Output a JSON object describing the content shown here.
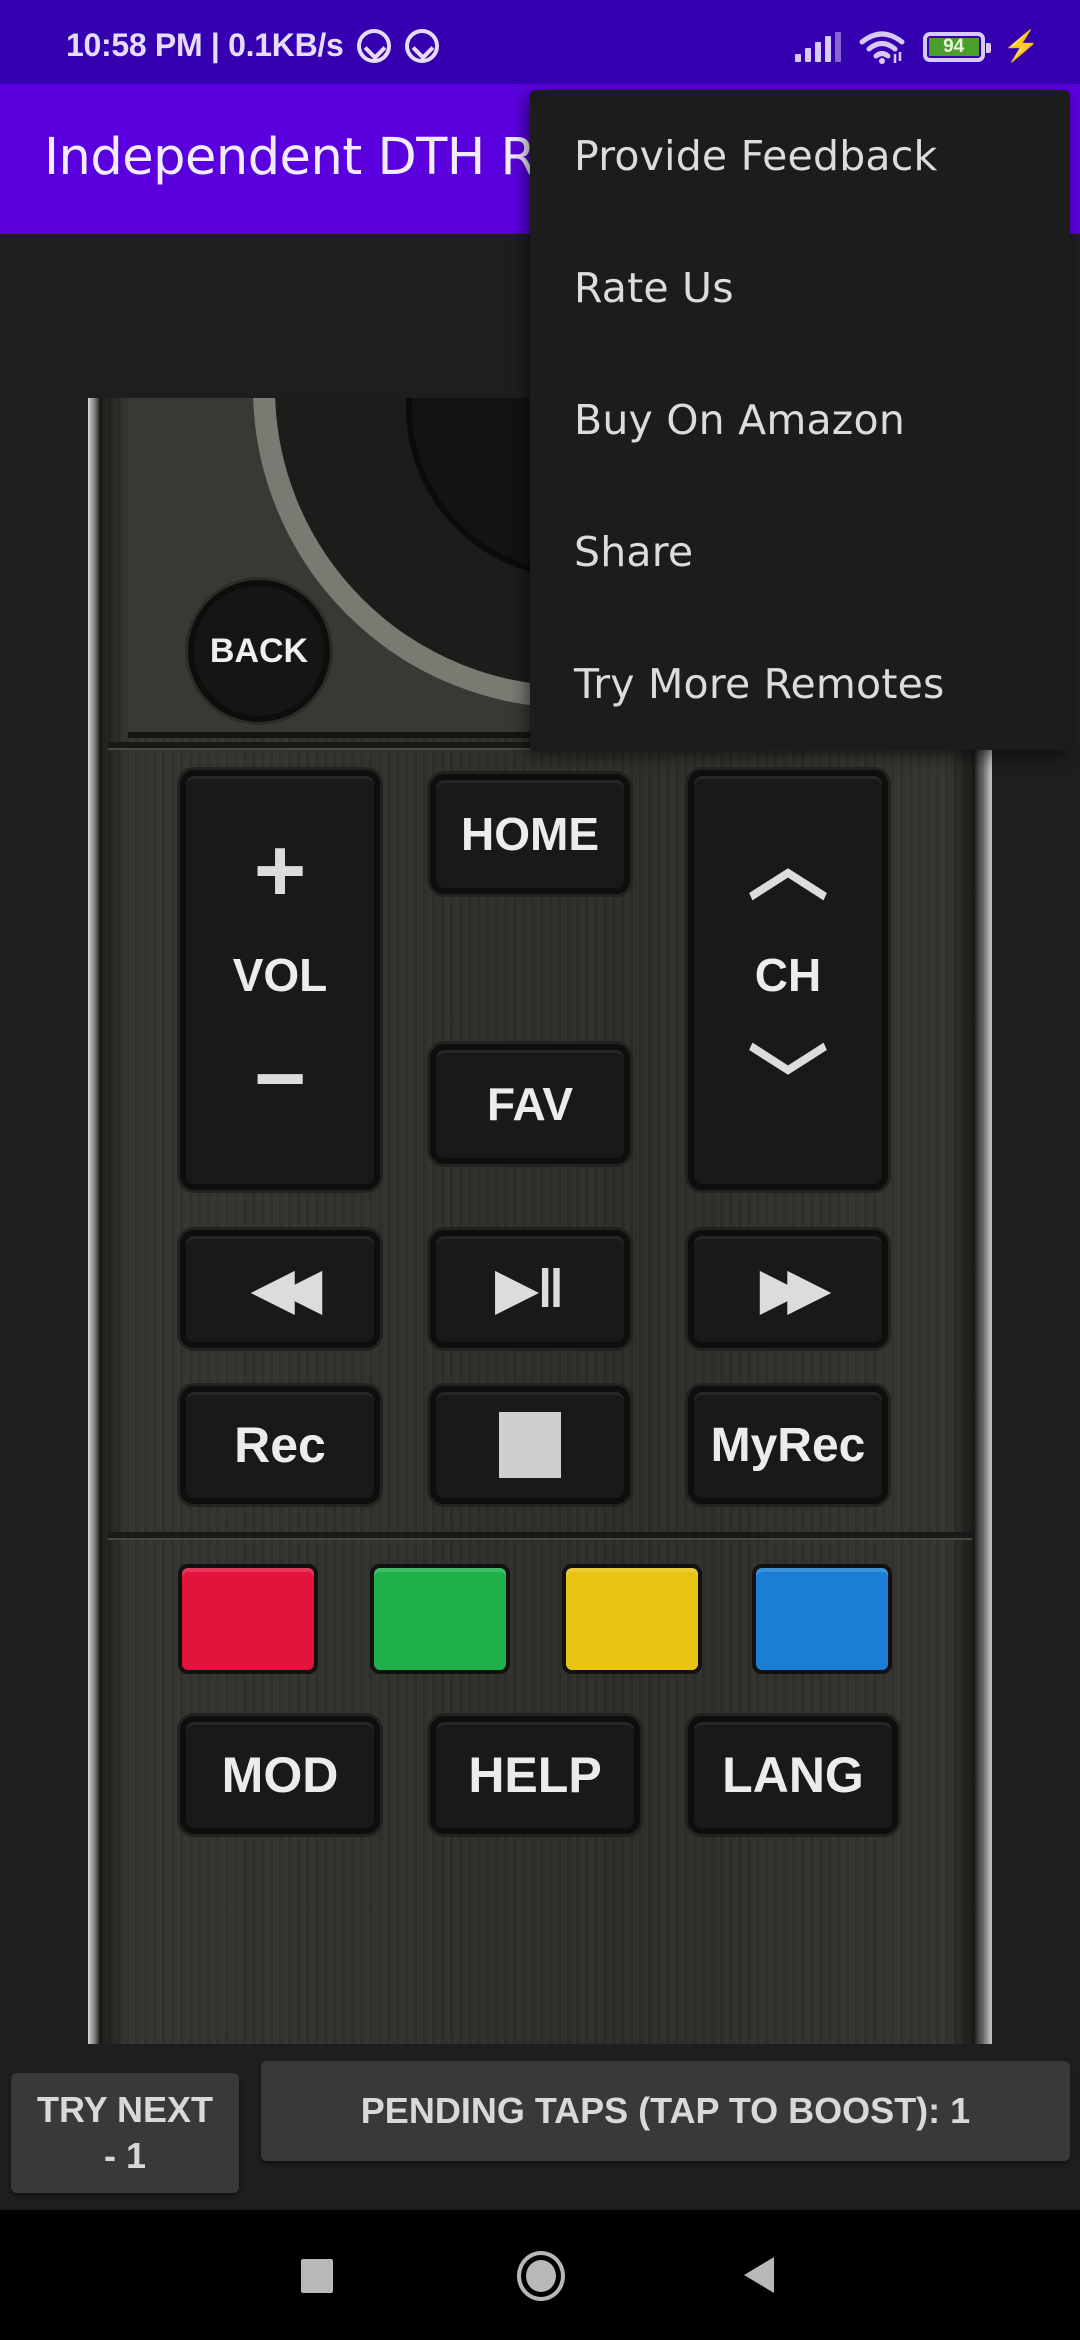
{
  "status_bar": {
    "time_speed": "10:58 PM | 0.1KB/s",
    "notification_icons": [
      "q-app-icon",
      "q-app-icon"
    ],
    "battery_level": "94",
    "charging": true
  },
  "app_bar": {
    "title": "Independent DTH Remote"
  },
  "overflow_menu": {
    "items": [
      {
        "label": "Provide Feedback"
      },
      {
        "label": "Rate Us"
      },
      {
        "label": "Buy On Amazon"
      },
      {
        "label": "Share"
      },
      {
        "label": "Try More Remotes"
      }
    ]
  },
  "remote": {
    "back": "BACK",
    "vol_plus": "+",
    "vol": "VOL",
    "vol_minus": "−",
    "home": "HOME",
    "fav": "FAV",
    "ch_up": "︿",
    "ch": "CH",
    "ch_down": "﹀",
    "rewind": "◀◀",
    "play_pause": "▶‖",
    "fast_forward": "▶▶",
    "rec": "Rec",
    "stop": "■",
    "myrec": "MyRec",
    "mod": "MOD",
    "help": "HELP",
    "lang": "LANG",
    "color_keys": {
      "red": "#e0143c",
      "green": "#1fb04a",
      "yellow": "#e8c414",
      "blue": "#1a7fd4"
    }
  },
  "bottom_buttons": {
    "try_next_line1": "TRY NEXT",
    "try_next_line2": "- 1",
    "pending_taps": "PENDING TAPS (TAP TO BOOST): 1"
  },
  "colors": {
    "status_bar": "#3500b0",
    "app_bar": "#5a00de",
    "background": "#1e1e1e",
    "menu_background": "#1c1c1c",
    "button_background": "#393939"
  }
}
